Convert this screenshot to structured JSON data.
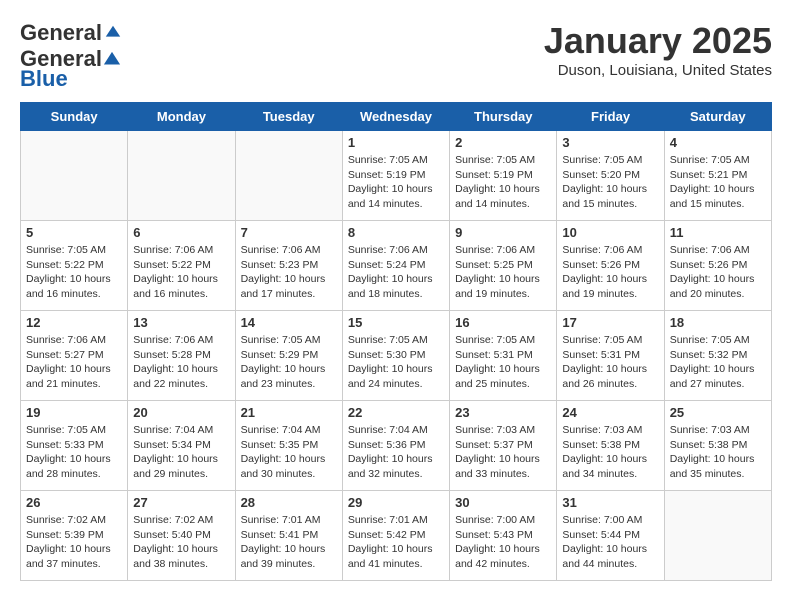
{
  "header": {
    "logo_general": "General",
    "logo_blue": "Blue",
    "title": "January 2025",
    "subtitle": "Duson, Louisiana, United States"
  },
  "weekdays": [
    "Sunday",
    "Monday",
    "Tuesday",
    "Wednesday",
    "Thursday",
    "Friday",
    "Saturday"
  ],
  "weeks": [
    [
      {
        "day": "",
        "info": ""
      },
      {
        "day": "",
        "info": ""
      },
      {
        "day": "",
        "info": ""
      },
      {
        "day": "1",
        "info": "Sunrise: 7:05 AM\nSunset: 5:19 PM\nDaylight: 10 hours\nand 14 minutes."
      },
      {
        "day": "2",
        "info": "Sunrise: 7:05 AM\nSunset: 5:19 PM\nDaylight: 10 hours\nand 14 minutes."
      },
      {
        "day": "3",
        "info": "Sunrise: 7:05 AM\nSunset: 5:20 PM\nDaylight: 10 hours\nand 15 minutes."
      },
      {
        "day": "4",
        "info": "Sunrise: 7:05 AM\nSunset: 5:21 PM\nDaylight: 10 hours\nand 15 minutes."
      }
    ],
    [
      {
        "day": "5",
        "info": "Sunrise: 7:05 AM\nSunset: 5:22 PM\nDaylight: 10 hours\nand 16 minutes."
      },
      {
        "day": "6",
        "info": "Sunrise: 7:06 AM\nSunset: 5:22 PM\nDaylight: 10 hours\nand 16 minutes."
      },
      {
        "day": "7",
        "info": "Sunrise: 7:06 AM\nSunset: 5:23 PM\nDaylight: 10 hours\nand 17 minutes."
      },
      {
        "day": "8",
        "info": "Sunrise: 7:06 AM\nSunset: 5:24 PM\nDaylight: 10 hours\nand 18 minutes."
      },
      {
        "day": "9",
        "info": "Sunrise: 7:06 AM\nSunset: 5:25 PM\nDaylight: 10 hours\nand 19 minutes."
      },
      {
        "day": "10",
        "info": "Sunrise: 7:06 AM\nSunset: 5:26 PM\nDaylight: 10 hours\nand 19 minutes."
      },
      {
        "day": "11",
        "info": "Sunrise: 7:06 AM\nSunset: 5:26 PM\nDaylight: 10 hours\nand 20 minutes."
      }
    ],
    [
      {
        "day": "12",
        "info": "Sunrise: 7:06 AM\nSunset: 5:27 PM\nDaylight: 10 hours\nand 21 minutes."
      },
      {
        "day": "13",
        "info": "Sunrise: 7:06 AM\nSunset: 5:28 PM\nDaylight: 10 hours\nand 22 minutes."
      },
      {
        "day": "14",
        "info": "Sunrise: 7:05 AM\nSunset: 5:29 PM\nDaylight: 10 hours\nand 23 minutes."
      },
      {
        "day": "15",
        "info": "Sunrise: 7:05 AM\nSunset: 5:30 PM\nDaylight: 10 hours\nand 24 minutes."
      },
      {
        "day": "16",
        "info": "Sunrise: 7:05 AM\nSunset: 5:31 PM\nDaylight: 10 hours\nand 25 minutes."
      },
      {
        "day": "17",
        "info": "Sunrise: 7:05 AM\nSunset: 5:31 PM\nDaylight: 10 hours\nand 26 minutes."
      },
      {
        "day": "18",
        "info": "Sunrise: 7:05 AM\nSunset: 5:32 PM\nDaylight: 10 hours\nand 27 minutes."
      }
    ],
    [
      {
        "day": "19",
        "info": "Sunrise: 7:05 AM\nSunset: 5:33 PM\nDaylight: 10 hours\nand 28 minutes."
      },
      {
        "day": "20",
        "info": "Sunrise: 7:04 AM\nSunset: 5:34 PM\nDaylight: 10 hours\nand 29 minutes."
      },
      {
        "day": "21",
        "info": "Sunrise: 7:04 AM\nSunset: 5:35 PM\nDaylight: 10 hours\nand 30 minutes."
      },
      {
        "day": "22",
        "info": "Sunrise: 7:04 AM\nSunset: 5:36 PM\nDaylight: 10 hours\nand 32 minutes."
      },
      {
        "day": "23",
        "info": "Sunrise: 7:03 AM\nSunset: 5:37 PM\nDaylight: 10 hours\nand 33 minutes."
      },
      {
        "day": "24",
        "info": "Sunrise: 7:03 AM\nSunset: 5:38 PM\nDaylight: 10 hours\nand 34 minutes."
      },
      {
        "day": "25",
        "info": "Sunrise: 7:03 AM\nSunset: 5:38 PM\nDaylight: 10 hours\nand 35 minutes."
      }
    ],
    [
      {
        "day": "26",
        "info": "Sunrise: 7:02 AM\nSunset: 5:39 PM\nDaylight: 10 hours\nand 37 minutes."
      },
      {
        "day": "27",
        "info": "Sunrise: 7:02 AM\nSunset: 5:40 PM\nDaylight: 10 hours\nand 38 minutes."
      },
      {
        "day": "28",
        "info": "Sunrise: 7:01 AM\nSunset: 5:41 PM\nDaylight: 10 hours\nand 39 minutes."
      },
      {
        "day": "29",
        "info": "Sunrise: 7:01 AM\nSunset: 5:42 PM\nDaylight: 10 hours\nand 41 minutes."
      },
      {
        "day": "30",
        "info": "Sunrise: 7:00 AM\nSunset: 5:43 PM\nDaylight: 10 hours\nand 42 minutes."
      },
      {
        "day": "31",
        "info": "Sunrise: 7:00 AM\nSunset: 5:44 PM\nDaylight: 10 hours\nand 44 minutes."
      },
      {
        "day": "",
        "info": ""
      }
    ]
  ]
}
